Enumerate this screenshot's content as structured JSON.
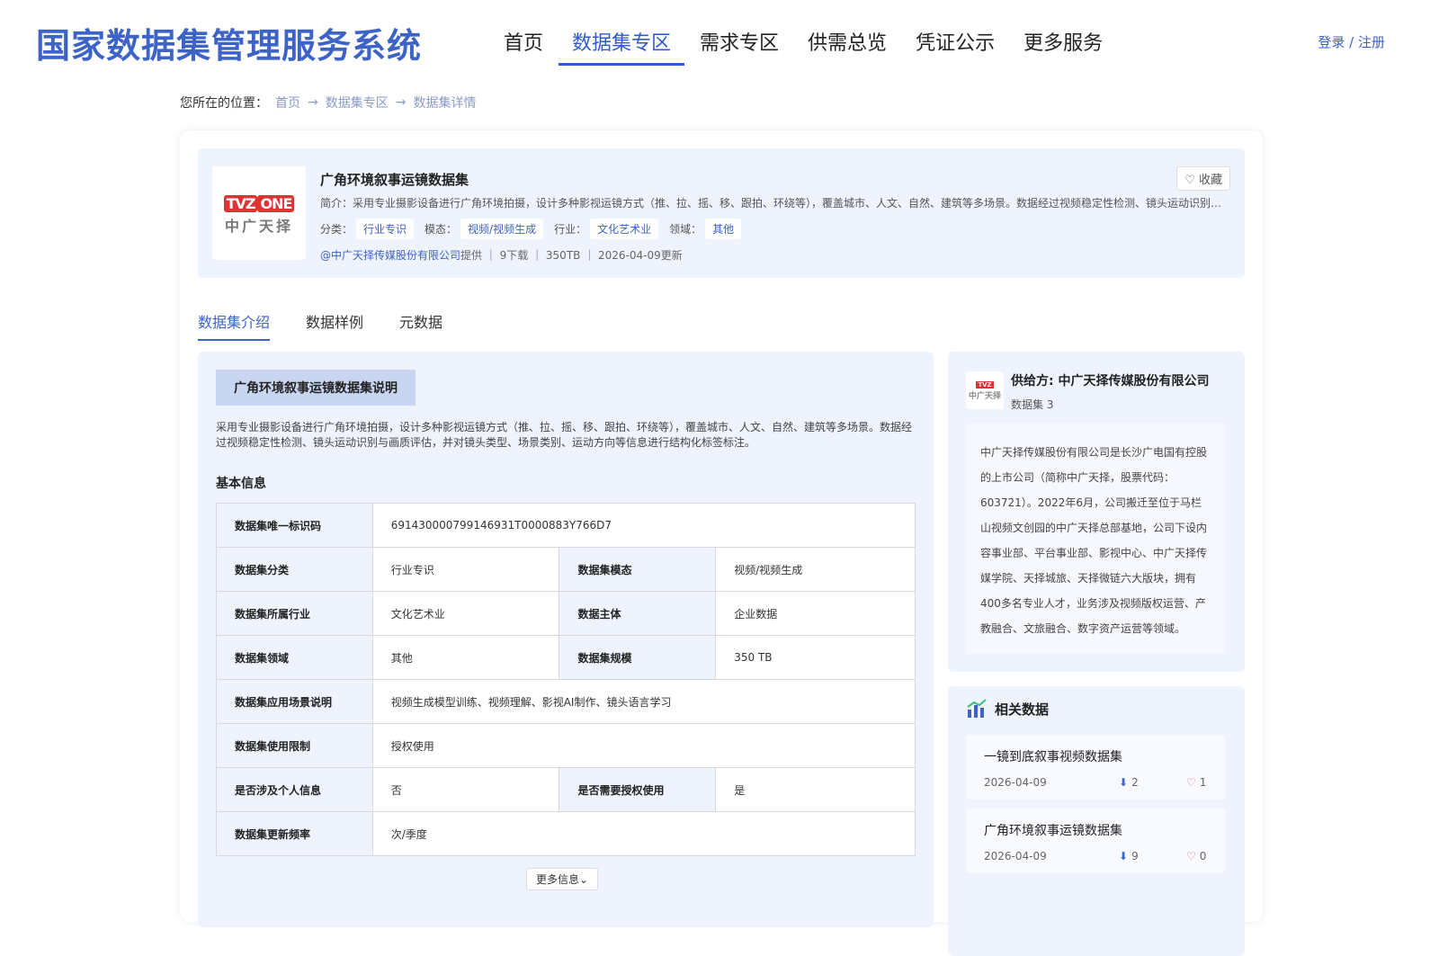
{
  "header": {
    "logo": "国家数据集管理服务系统",
    "nav": [
      "首页",
      "数据集专区",
      "需求专区",
      "供需总览",
      "凭证公示",
      "更多服务"
    ],
    "login": "登录 / 注册"
  },
  "breadcrumb": {
    "prefix": "您所在的位置：",
    "items": [
      "首页",
      "数据集专区",
      "数据集详情"
    ]
  },
  "dataset": {
    "logo_main": "TVZ",
    "logo_badge": "ONE",
    "logo_sub": "中广天择",
    "title": "广角环境叙事运镜数据集",
    "fav": "收藏",
    "intro": "简介：采用专业摄影设备进行广角环境拍摄，设计多种影视运镜方式（推、拉、摇、移、跟拍、环绕等），覆盖城市、人文、自然、建筑等多场景。数据经过视频稳定性检测、镜头运动识别与画质评估，并对镜头类型、场景类别、运动方向等信息进行结构化标签标注。",
    "tags": [
      {
        "k": "分类：",
        "v": "行业专识"
      },
      {
        "k": "模态：",
        "v": "视频/视频生成"
      },
      {
        "k": "行业：",
        "v": "文化艺术业"
      },
      {
        "k": "领域：",
        "v": "其他"
      }
    ],
    "provider_link": "@中广天择传媒股份有限公司",
    "meta": "提供 ｜ 9下载 ｜ 350TB ｜ 2026-04-09更新"
  },
  "tabs": [
    "数据集介绍",
    "数据样例",
    "元数据"
  ],
  "main": {
    "title": "广角环境叙事运镜数据集说明",
    "desc": "采用专业摄影设备进行广角环境拍摄，设计多种影视运镜方式（推、拉、摇、移、跟拍、环绕等），覆盖城市、人文、自然、建筑等多场景。数据经过视频稳定性检测、镜头运动识别与画质评估，并对镜头类型、场景类别、运动方向等信息进行结构化标签标注。",
    "basic_title": "基本信息",
    "rows": {
      "id_k": "数据集唯一标识码",
      "id_v": "691430000799146931T0000883Y766D7",
      "cat_k": "数据集分类",
      "cat_v": "行业专识",
      "mod_k": "数据集模态",
      "mod_v": "视频/视频生成",
      "ind_k": "数据集所属行业",
      "ind_v": "文化艺术业",
      "sub_k": "数据主体",
      "sub_v": "企业数据",
      "dom_k": "数据集领域",
      "dom_v": "其他",
      "size_k": "数据集规模",
      "size_v": "350 TB",
      "app_k": "数据集应用场景说明",
      "app_v": "视频生成模型训练、视频理解、影视AI制作、镜头语言学习",
      "lim_k": "数据集使用限制",
      "lim_v": "授权使用",
      "pi_k": "是否涉及个人信息",
      "pi_v": "否",
      "auth_k": "是否需要授权使用",
      "auth_v": "是",
      "freq_k": "数据集更新频率",
      "freq_v": "次/季度"
    },
    "more": "更多信息"
  },
  "provider": {
    "name": "供给方: 中广天择传媒股份有限公司",
    "count": "数据集 3",
    "desc": "中广天择传媒股份有限公司是长沙广电国有控股的上市公司（简称中广天择，股票代码：603721）。2022年6月，公司搬迁至位于马栏山视频文创园的中广天择总部基地，公司下设内容事业部、平台事业部、影视中心、中广天择传媒学院、天择城旅、天择微链六大版块，拥有400多名专业人才，业务涉及视频版权运营、产教融合、文旅融合、数字资产运营等领域。"
  },
  "related": {
    "title": "相关数据",
    "items": [
      {
        "title": "一镜到底叙事视频数据集",
        "date": "2026-04-09",
        "downloads": "2",
        "likes": "1"
      },
      {
        "title": "广角环境叙事运镜数据集",
        "date": "2026-04-09",
        "downloads": "9",
        "likes": "0"
      }
    ]
  }
}
